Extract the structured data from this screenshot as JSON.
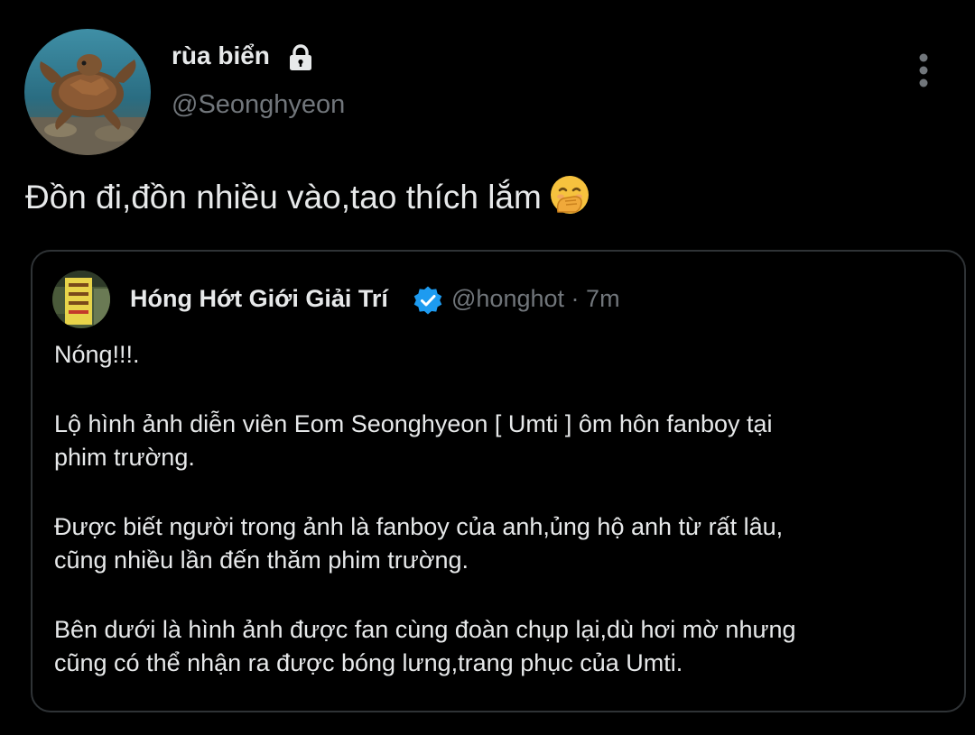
{
  "tweet": {
    "display_name": "rùa biển",
    "handle": "@Seonghyeon",
    "text": "Đồn đi,đồn nhiều vào,tao thích lắm",
    "icons": {
      "lock": "lock-icon",
      "more": "more-vertical-icon",
      "emoji": "face-with-hand-over-mouth-emoji"
    }
  },
  "quote": {
    "display_name": "Hóng Hớt Giới Giải Trí",
    "handle": "@honghot",
    "separator": "·",
    "time": "7m",
    "verified_icon": "verified-badge-icon",
    "paragraphs": [
      {
        "lines": [
          "Nóng!!!."
        ]
      },
      {
        "lines": [
          "Lộ hình ảnh diễn viên Eom Seonghyeon [ Umti ] ôm hôn fanboy tại",
          "phim trường."
        ]
      },
      {
        "lines": [
          "Được biết người trong ảnh là fanboy của anh,ủng hộ anh từ rất lâu,",
          "cũng nhiều lần đến thăm phim trường."
        ]
      },
      {
        "lines": [
          "Bên dưới là hình ảnh được fan cùng đoàn chụp lại,dù hơi mờ nhưng",
          "cũng có thể nhận ra được bóng lưng,trang phục của Umti."
        ]
      }
    ]
  },
  "colors": {
    "background": "#000000",
    "primary_text": "#e7e9ea",
    "secondary_text": "#71767b",
    "border": "#2f3336",
    "verified": "#1d9bf0"
  }
}
